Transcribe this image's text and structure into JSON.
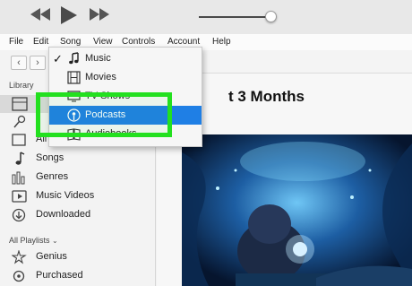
{
  "menubar": {
    "items": [
      "File",
      "Edit",
      "Song",
      "View",
      "Controls",
      "Account",
      "Help"
    ]
  },
  "sidebar": {
    "library_label": "Library",
    "items": [
      {
        "label": "All",
        "icon": "album-icon"
      },
      {
        "label": "Songs",
        "icon": "music-note-icon"
      },
      {
        "label": "Genres",
        "icon": "genres-icon"
      },
      {
        "label": "Music Videos",
        "icon": "music-video-icon"
      },
      {
        "label": "Downloaded",
        "icon": "downloaded-icon"
      }
    ],
    "playlists_label": "All Playlists",
    "playlists": [
      {
        "label": "Genius",
        "icon": "genius-icon"
      },
      {
        "label": "Purchased",
        "icon": "purchased-icon"
      }
    ]
  },
  "main": {
    "title": "t 3 Months"
  },
  "dropdown": {
    "items": [
      {
        "label": "Music",
        "checked": true,
        "icon": "music-note-icon"
      },
      {
        "label": "Movies",
        "checked": false,
        "icon": "film-icon"
      },
      {
        "label": "TV Shows",
        "checked": false,
        "icon": "tv-icon"
      },
      {
        "label": "Podcasts",
        "checked": false,
        "icon": "podcast-icon",
        "selected": true
      },
      {
        "label": "Audiobooks",
        "checked": false,
        "icon": "book-icon"
      }
    ]
  },
  "colors": {
    "highlight": "#23e01f",
    "selection": "#1f7fe5"
  }
}
